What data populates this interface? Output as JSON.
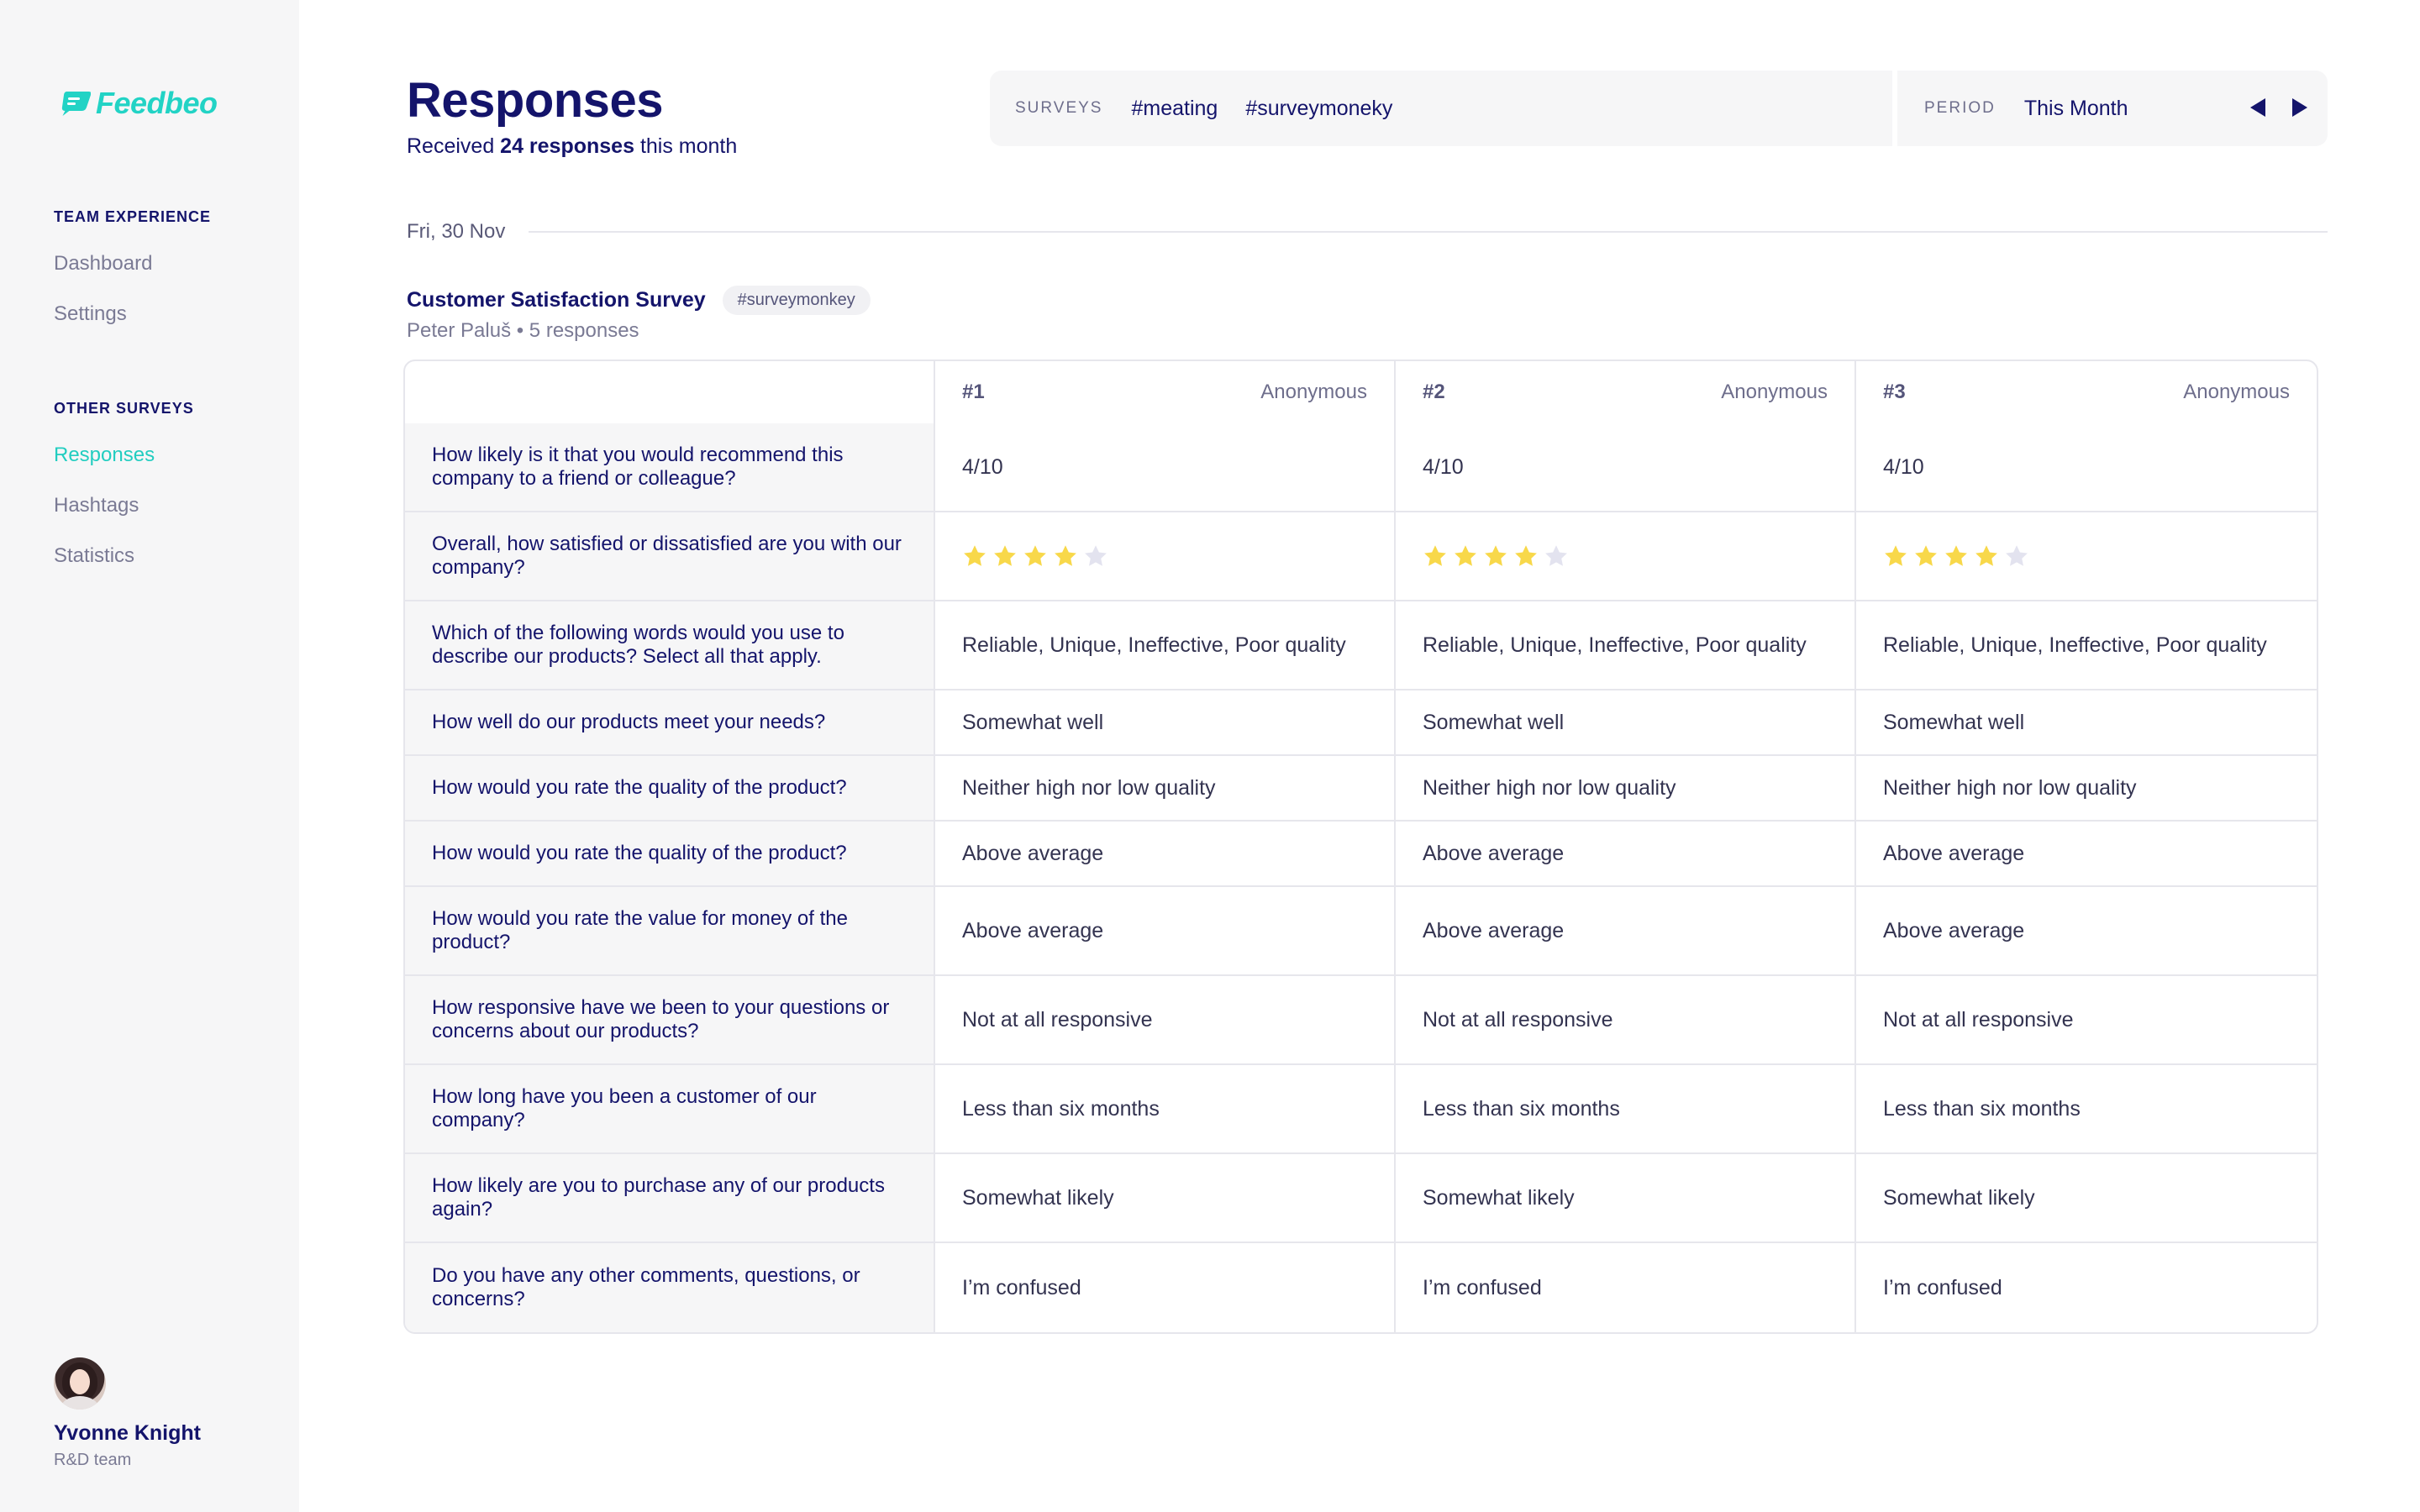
{
  "app": {
    "logo_text": "Feedbeo"
  },
  "sidebar": {
    "groups": [
      {
        "title": "TEAM EXPERIENCE",
        "items": [
          {
            "label": "Dashboard"
          },
          {
            "label": "Settings"
          }
        ]
      },
      {
        "title": "OTHER SURVEYS",
        "items": [
          {
            "label": "Responses",
            "active": true
          },
          {
            "label": "Hashtags"
          },
          {
            "label": "Statistics"
          }
        ]
      }
    ],
    "user": {
      "name": "Yvonne Knight",
      "team": "R&D team"
    }
  },
  "header": {
    "title": "Responses",
    "subtitle_pre": "Received ",
    "subtitle_bold": "24 responses",
    "subtitle_post": " this month"
  },
  "filters": {
    "surveys_label": "SURVEYS",
    "survey_tags": [
      "#meating",
      "#surveymoneky"
    ],
    "period_label": "PERIOD",
    "period_value": "This Month"
  },
  "date_label": "Fri, 30 Nov",
  "survey": {
    "title": "Customer Satisfaction Survey",
    "tag": "#surveymonkey",
    "meta": "Peter Paluš • 5 responses"
  },
  "table": {
    "responses": [
      {
        "num": "#1",
        "author": "Anonymous"
      },
      {
        "num": "#2",
        "author": "Anonymous"
      },
      {
        "num": "#3",
        "author": "Anonymous"
      }
    ],
    "rows": [
      {
        "question": "How likely is it that you would recommend this company to a friend or colleague?",
        "type": "text",
        "answers": [
          "4/10",
          "4/10",
          "4/10"
        ]
      },
      {
        "question": "Overall, how satisfied or dissatisfied are you with our company?",
        "type": "stars",
        "max": 5,
        "answers": [
          4,
          4,
          4
        ]
      },
      {
        "question": "Which of the following words would you use to describe our products? Select all that apply.",
        "type": "text",
        "answers": [
          "Reliable, Unique, Ineffective, Poor quality",
          "Reliable, Unique, Ineffective, Poor quality",
          "Reliable, Unique, Ineffective, Poor quality"
        ]
      },
      {
        "question": "How well do our products meet your needs?",
        "type": "text",
        "answers": [
          "Somewhat well",
          "Somewhat well",
          "Somewhat well"
        ]
      },
      {
        "question": "How would you rate the quality of the product?",
        "type": "text",
        "answers": [
          "Neither high nor low quality",
          "Neither high nor low quality",
          "Neither high nor low quality"
        ]
      },
      {
        "question": "How would you rate the quality of the product?",
        "type": "text",
        "answers": [
          "Above average",
          "Above average",
          "Above average"
        ]
      },
      {
        "question": "How would you rate the value for money of the product?",
        "type": "text",
        "answers": [
          "Above average",
          "Above average",
          "Above average"
        ]
      },
      {
        "question": "How responsive have we been to your questions or concerns about our products?",
        "type": "text",
        "answers": [
          "Not at all responsive",
          "Not at all responsive",
          "Not at all responsive"
        ]
      },
      {
        "question": "How long have you been a customer of our company?",
        "type": "text",
        "answers": [
          "Less than six months",
          "Less than six months",
          "Less than six months"
        ]
      },
      {
        "question": "How likely are you to purchase any of our products again?",
        "type": "text",
        "answers": [
          "Somewhat likely",
          "Somewhat likely",
          "Somewhat likely"
        ]
      },
      {
        "question": "Do you have any other comments, questions, or concerns?",
        "type": "text",
        "answers": [
          "I’m confused",
          "I’m confused",
          "I’m confused"
        ]
      }
    ]
  },
  "colors": {
    "accent": "#22cdc0",
    "navy": "#14146b",
    "star_filled": "#f8d84a",
    "star_empty": "#e3e3ef",
    "sidebar_bg": "#f6f6f7"
  }
}
